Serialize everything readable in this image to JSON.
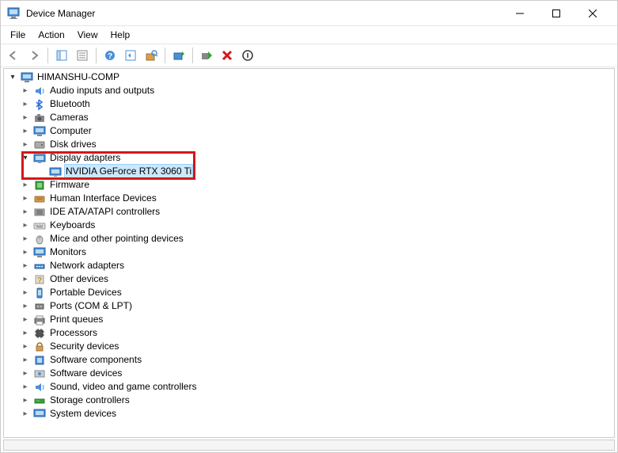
{
  "window": {
    "title": "Device Manager"
  },
  "menu": {
    "file": "File",
    "action": "Action",
    "view": "View",
    "help": "Help"
  },
  "tree": {
    "root": "HIMANSHU-COMP",
    "nodes": {
      "audio": "Audio inputs and outputs",
      "bluetooth": "Bluetooth",
      "cameras": "Cameras",
      "computer": "Computer",
      "disk": "Disk drives",
      "display": "Display adapters",
      "display_child": "NVIDIA GeForce RTX 3060 Ti",
      "firmware": "Firmware",
      "hid": "Human Interface Devices",
      "ide": "IDE ATA/ATAPI controllers",
      "keyboards": "Keyboards",
      "mice": "Mice and other pointing devices",
      "monitors": "Monitors",
      "network": "Network adapters",
      "other": "Other devices",
      "portable": "Portable Devices",
      "ports": "Ports (COM & LPT)",
      "printq": "Print queues",
      "processors": "Processors",
      "security": "Security devices",
      "swcomp": "Software components",
      "swdev": "Software devices",
      "sound": "Sound, video and game controllers",
      "storage": "Storage controllers",
      "system": "System devices"
    }
  }
}
